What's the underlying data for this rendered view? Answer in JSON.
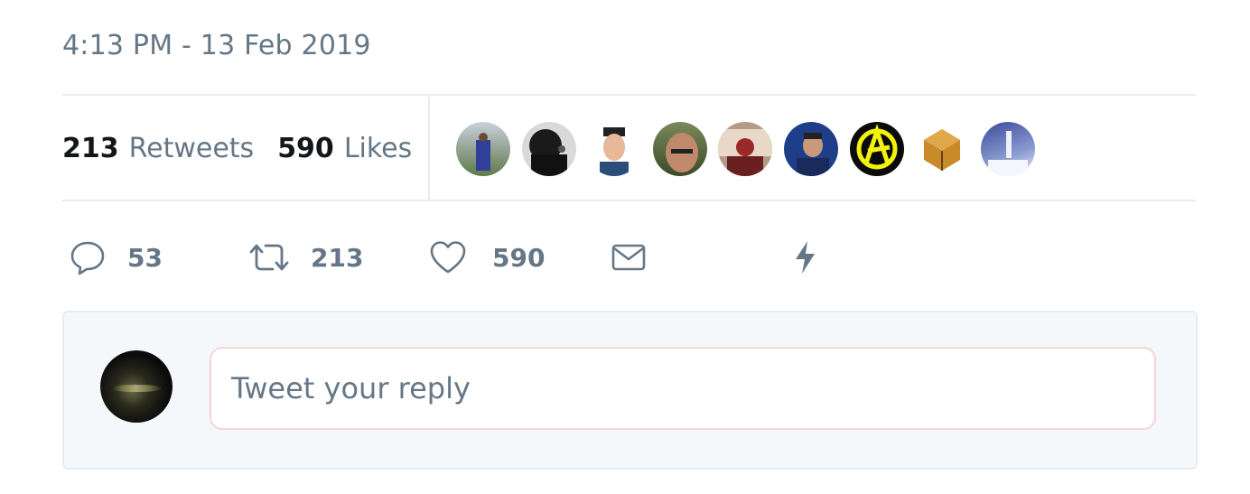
{
  "tweet": {
    "timestamp": "4:13 PM - 13 Feb 2019"
  },
  "stats": {
    "retweets_count": "213",
    "retweets_label": "Retweets",
    "likes_count": "590",
    "likes_label": "Likes"
  },
  "liked_by_avatars": [
    {
      "name": "avatar-1",
      "color": "#7a8a6a"
    },
    {
      "name": "avatar-2",
      "color": "#3a3a3a"
    },
    {
      "name": "avatar-3",
      "color": "#e8e8e8"
    },
    {
      "name": "avatar-4",
      "color": "#b0886a"
    },
    {
      "name": "avatar-5",
      "color": "#a08070"
    },
    {
      "name": "avatar-6",
      "color": "#2a4a8a"
    },
    {
      "name": "avatar-7",
      "color": "#111111"
    },
    {
      "name": "avatar-8",
      "color": "#c08a30"
    },
    {
      "name": "avatar-9",
      "color": "#6a78b8"
    }
  ],
  "actions": {
    "reply_count": "53",
    "retweet_count": "213",
    "like_count": "590",
    "reply_icon": "speech-bubble-icon",
    "retweet_icon": "retweet-icon",
    "like_icon": "heart-icon",
    "dm_icon": "envelope-icon",
    "analytics_icon": "lightning-icon"
  },
  "reply": {
    "placeholder": "Tweet your reply"
  },
  "colors": {
    "text_secondary": "#657786",
    "text_primary": "#14171a",
    "divider": "#e6ecf0",
    "reply_bg": "#f5f8fa",
    "input_border": "#f7d3d6"
  }
}
